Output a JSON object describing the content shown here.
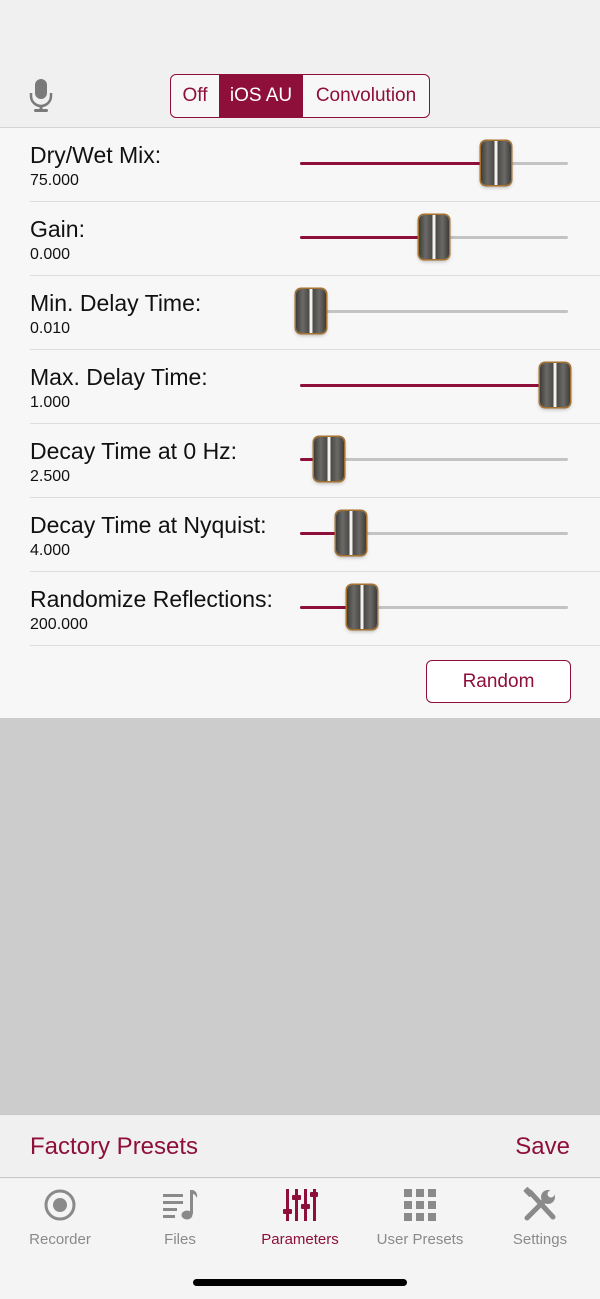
{
  "header": {
    "modes": [
      {
        "label": "Off",
        "active": false
      },
      {
        "label": "iOS AU",
        "active": true
      },
      {
        "label": "Convolution",
        "active": false
      }
    ]
  },
  "parameters": [
    {
      "label": "Dry/Wet Mix:",
      "value": "75.000",
      "level": 0.73
    },
    {
      "label": "Gain:",
      "value": "0.000",
      "level": 0.5
    },
    {
      "label": "Min. Delay Time:",
      "value": "0.010",
      "level": 0.04
    },
    {
      "label": "Max. Delay Time:",
      "value": "1.000",
      "level": 0.95
    },
    {
      "label": "Decay Time at 0 Hz:",
      "value": "2.500",
      "level": 0.11
    },
    {
      "label": "Decay Time at Nyquist:",
      "value": "4.000",
      "level": 0.19
    },
    {
      "label": "Randomize Reflections:",
      "value": "200.000",
      "level": 0.23
    }
  ],
  "random_button": "Random",
  "presets_bar": {
    "factory": "Factory Presets",
    "save": "Save"
  },
  "tabs": [
    {
      "label": "Recorder",
      "icon": "record-icon",
      "active": false
    },
    {
      "label": "Files",
      "icon": "music-list-icon",
      "active": false
    },
    {
      "label": "Parameters",
      "icon": "sliders-icon",
      "active": true
    },
    {
      "label": "User Presets",
      "icon": "grid-icon",
      "active": false
    },
    {
      "label": "Settings",
      "icon": "tools-icon",
      "active": false
    }
  ],
  "colors": {
    "accent": "#8d0f3a",
    "inactive": "#8a8a8a",
    "track": "#c3c3c3"
  }
}
